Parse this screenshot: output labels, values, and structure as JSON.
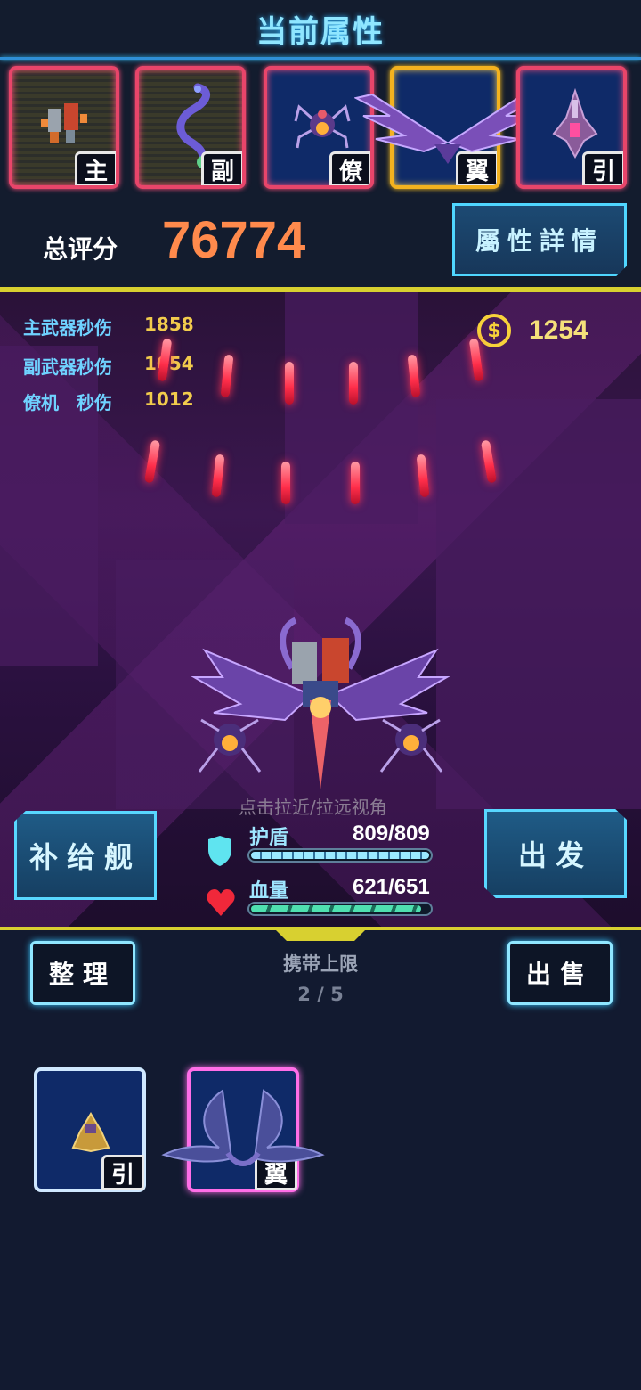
{
  "header": {
    "title": "当前属性",
    "score_label": "总评分",
    "score_value": "76774",
    "detail_button": "屬性詳情"
  },
  "equipment_slots": [
    {
      "badge": "主",
      "frame_color": "#e8456a"
    },
    {
      "badge": "副",
      "frame_color": "#e8456a"
    },
    {
      "badge": "僚",
      "frame_color": "#e8456a"
    },
    {
      "badge": "翼",
      "frame_color": "#f3b21f"
    },
    {
      "badge": "引",
      "frame_color": "#e8456a"
    }
  ],
  "stats": [
    {
      "label": "主武器秒伤",
      "value": "1858"
    },
    {
      "label": "副武器秒伤",
      "value": "1054"
    },
    {
      "label": "僚机　秒伤",
      "value": "1012"
    }
  ],
  "currency": {
    "icon": "coin-icon",
    "value": "1254"
  },
  "scene": {
    "hint": "点击拉近/拉远视角",
    "supply_button": "补给舰",
    "go_button": "出发",
    "shield": {
      "label": "护盾",
      "value": "809/809",
      "fraction": 1.0
    },
    "hp": {
      "label": "血量",
      "value": "621/651",
      "fraction": 0.954
    }
  },
  "inventory": {
    "sort_button": "整理",
    "sell_button": "出售",
    "capacity_label": "携带上限",
    "capacity_value": "2 / 5",
    "items": [
      {
        "badge": "引",
        "frame_color": "#cfe8ff"
      },
      {
        "badge": "翼",
        "frame_color": "#ff6ee8"
      }
    ]
  }
}
